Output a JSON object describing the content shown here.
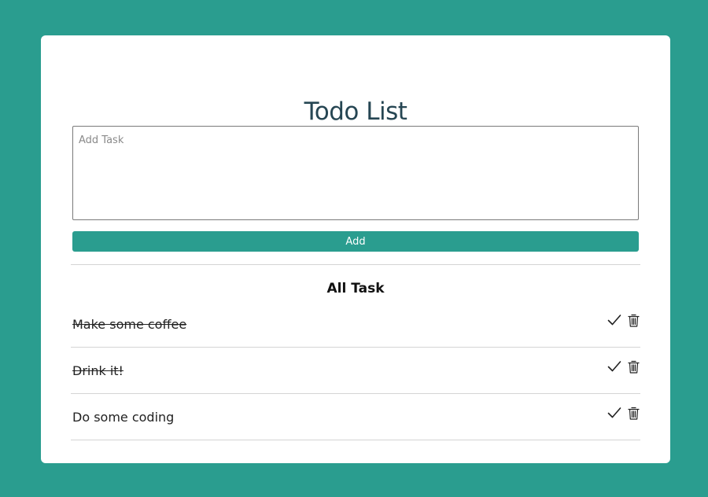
{
  "header": {
    "title": "Todo List"
  },
  "form": {
    "placeholder": "Add Task",
    "value": "",
    "add_label": "Add"
  },
  "list": {
    "heading": "All Task",
    "tasks": [
      {
        "text": "Make some coffee",
        "done": true
      },
      {
        "text": "Drink it!",
        "done": true
      },
      {
        "text": "Do some coding",
        "done": false
      }
    ]
  },
  "icons": {
    "complete": "check-icon",
    "delete": "trash-icon"
  },
  "colors": {
    "background": "#2a9d8f",
    "accent": "#2a9d8f",
    "title": "#264653"
  }
}
